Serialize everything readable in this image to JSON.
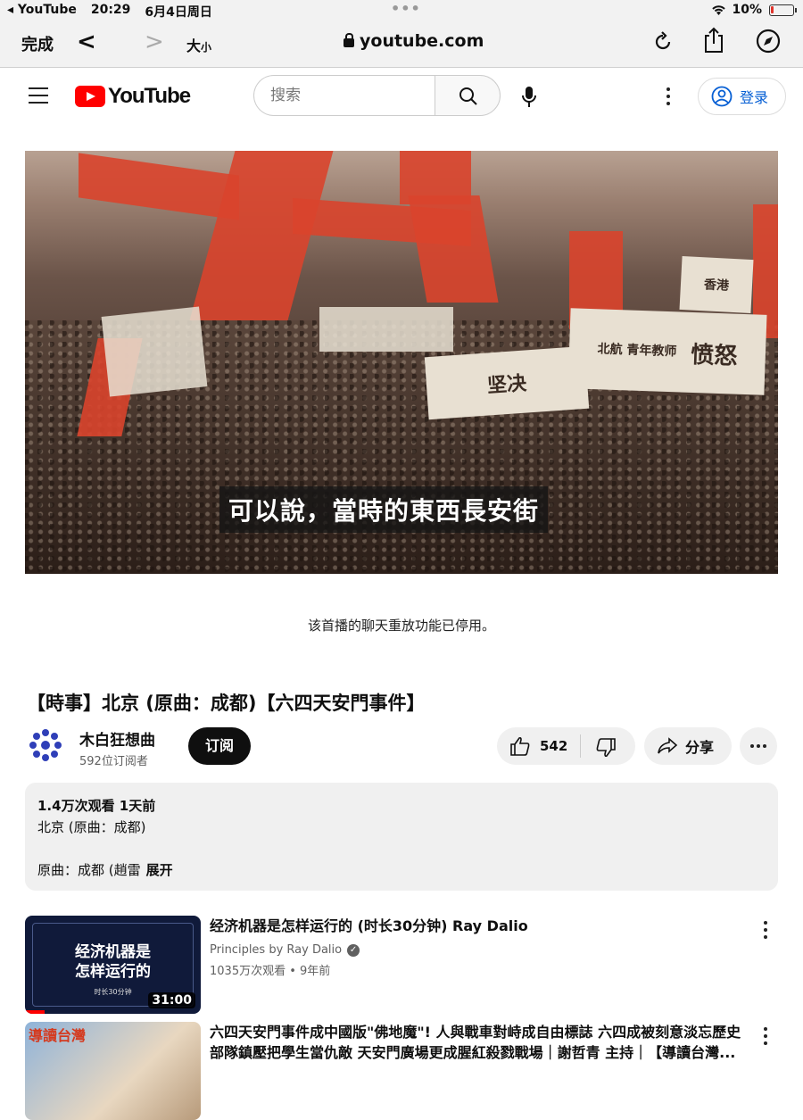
{
  "status": {
    "carrier": "YouTube",
    "time": "20:29",
    "date": "6月4日周日",
    "battery": "10%"
  },
  "safari": {
    "done": "完成",
    "text_size": "大",
    "text_size_small": "小",
    "url": "youtube.com"
  },
  "yt": {
    "logo_text": "YouTube",
    "search_placeholder": "搜索",
    "signin": "登录"
  },
  "video": {
    "subtitle": "可以說，當時的東西長安街",
    "banners": [
      "愤怒",
      "北航 青年教师",
      "坚决",
      "香港"
    ]
  },
  "chat_notice": "该首播的聊天重放功能已停用。",
  "title": "【時事】北京 (原曲：成都)【六四天安門事件】",
  "channel": {
    "name": "木白狂想曲",
    "subscribers": "592位订阅者",
    "subscribe": "订阅"
  },
  "actions": {
    "likes": "542",
    "share": "分享"
  },
  "description": {
    "stats": "1.4万次观看  1天前",
    "line1": "北京 (原曲：成都)",
    "line2": "原曲：成都 (趙雷",
    "expand": "展开"
  },
  "recommendations": [
    {
      "title": "经济机器是怎样运行的 (时长30分钟) Ray Dalio",
      "channel": "Principles by Ray Dalio",
      "meta": "1035万次观看 • 9年前",
      "duration": "31:00",
      "thumb_text1": "经济机器是",
      "thumb_text2": "怎样运行的",
      "thumb_text3": "时长30分钟"
    },
    {
      "title": "六四天安門事件成中國版\"佛地魔\"! 人與戰車對峙成自由標誌 六四成被刻意淡忘歷史 部隊鎮壓把學生當仇敵 天安門廣場更成腥紅殺戮戰場｜謝哲青 主持｜【導讀台灣...",
      "thumb_text": "導讀台灣"
    }
  ],
  "colors": {
    "accent": "#ff0000",
    "link": "#065fd4",
    "pill": "#f0f0f0"
  }
}
